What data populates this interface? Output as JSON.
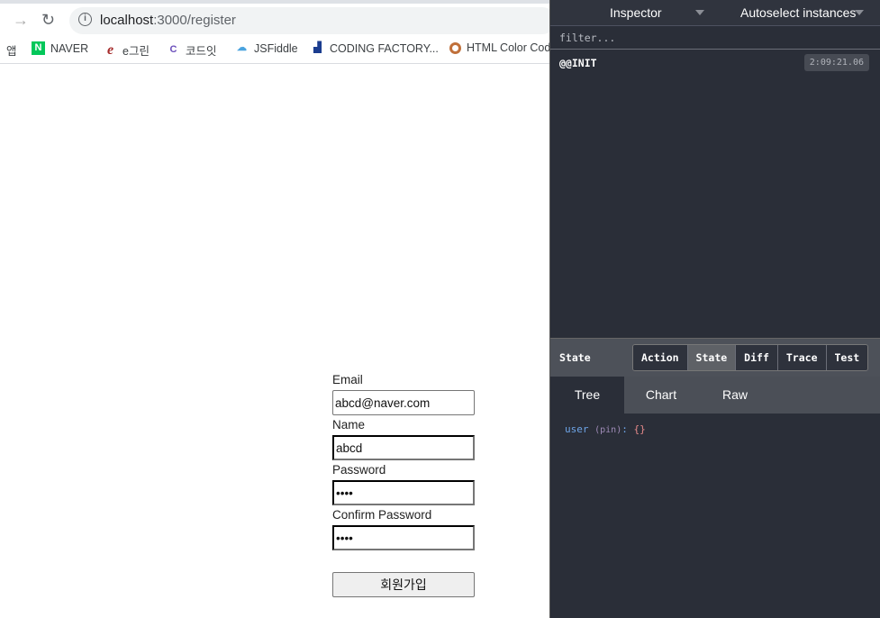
{
  "browser": {
    "url_host": "localhost",
    "url_rest": ":3000/register",
    "bookmarks": [
      {
        "label": "앱",
        "icon": "apps-icon"
      },
      {
        "label": "NAVER",
        "icon": "naver-icon"
      },
      {
        "label": "e그린",
        "icon": "egreen-icon"
      },
      {
        "label": "코드잇",
        "icon": "codeit-icon"
      },
      {
        "label": "JSFiddle",
        "icon": "jsfiddle-icon"
      },
      {
        "label": "CODING FACTORY...",
        "icon": "codingfactory-icon"
      },
      {
        "label": "HTML Color Codes",
        "icon": "htmlcolor-icon"
      }
    ]
  },
  "form": {
    "email_label": "Email",
    "email_value": "abcd@naver.com",
    "name_label": "Name",
    "name_value": "abcd",
    "password_label": "Password",
    "password_value": "abcd",
    "confirm_label": "Confirm Password",
    "confirm_value": "abcd",
    "submit_label": "회원가입"
  },
  "devtools": {
    "monitor": "Inspector",
    "instances": "Autoselect instances",
    "filter_placeholder": "filter...",
    "actions": [
      {
        "name": "@@INIT",
        "time": "2:09:21.06"
      }
    ],
    "state_label": "State",
    "buttons": [
      "Action",
      "State",
      "Diff",
      "Trace",
      "Test"
    ],
    "tabs": [
      "Tree",
      "Chart",
      "Raw"
    ],
    "tree": {
      "key": "user",
      "pin": "(pin)",
      "colon": ":",
      "value": "{}"
    }
  }
}
